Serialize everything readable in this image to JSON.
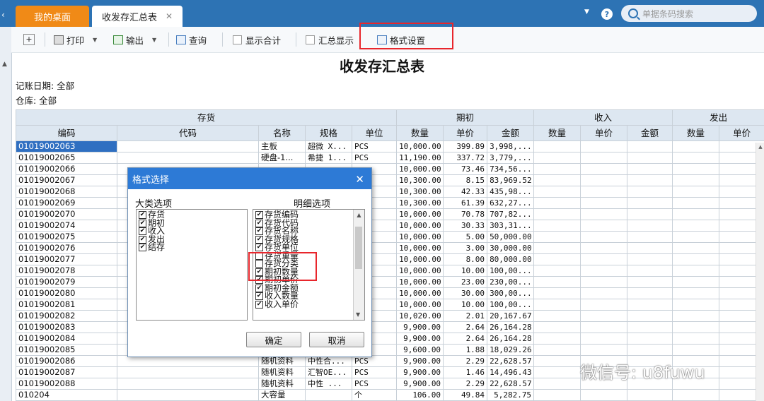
{
  "tabs": {
    "home": "我的桌面",
    "active": "收发存汇总表",
    "close": "✕"
  },
  "search": {
    "placeholder": "单据条码搜索"
  },
  "help": "?",
  "toolbar": {
    "add": "+",
    "print": "打印",
    "export": "输出",
    "query": "查询",
    "show_total": "显示合计",
    "summary_show": "汇总显示",
    "format_settings": "格式设置"
  },
  "report": {
    "title": "收发存汇总表",
    "date_filter": "记账日期: 全部",
    "warehouse_filter": "仓库: 全部"
  },
  "table": {
    "groups": [
      "存货",
      "期初",
      "收入",
      "发出"
    ],
    "columns": [
      "编码",
      "代码",
      "名称",
      "规格",
      "单位",
      "数量",
      "单价",
      "金额",
      "数量",
      "单价",
      "金额",
      "数量",
      "单价"
    ],
    "rows": [
      [
        "01019002063",
        "",
        "主板",
        "超微 X...",
        "PCS",
        "10,000.00",
        "399.89",
        "3,998,..."
      ],
      [
        "01019002065",
        "",
        "硬盘-1...",
        "希捷 1...",
        "PCS",
        "11,190.00",
        "337.72",
        "3,779,..."
      ],
      [
        "01019002066",
        "",
        "",
        "",
        "",
        "10,000.00",
        "73.46",
        "734,56..."
      ],
      [
        "01019002067",
        "",
        "",
        "",
        "",
        "10,300.00",
        "8.15",
        "83,969.52"
      ],
      [
        "01019002068",
        "",
        "",
        "",
        "",
        "10,300.00",
        "42.33",
        "435,98..."
      ],
      [
        "01019002069",
        "",
        "",
        "",
        "",
        "10,300.00",
        "61.39",
        "632,27..."
      ],
      [
        "01019002070",
        "",
        "",
        "",
        "",
        "10,000.00",
        "70.78",
        "707,82..."
      ],
      [
        "01019002074",
        "",
        "",
        "",
        "",
        "10,000.00",
        "30.33",
        "303,31..."
      ],
      [
        "01019002075",
        "",
        "",
        "",
        "",
        "10,000.00",
        "5.00",
        "50,000.00"
      ],
      [
        "01019002076",
        "",
        "",
        "",
        "",
        "10,000.00",
        "3.00",
        "30,000.00"
      ],
      [
        "01019002077",
        "",
        "",
        "",
        "",
        "10,000.00",
        "8.00",
        "80,000.00"
      ],
      [
        "01019002078",
        "",
        "",
        "",
        "",
        "10,000.00",
        "10.00",
        "100,00..."
      ],
      [
        "01019002079",
        "",
        "",
        "",
        "",
        "10,000.00",
        "23.00",
        "230,00..."
      ],
      [
        "01019002080",
        "",
        "",
        "",
        "",
        "10,000.00",
        "30.00",
        "300,00..."
      ],
      [
        "01019002081",
        "",
        "",
        "",
        "",
        "10,000.00",
        "10.00",
        "100,00..."
      ],
      [
        "01019002082",
        "",
        "",
        "",
        "",
        "10,020.00",
        "2.01",
        "20,167.67"
      ],
      [
        "01019002083",
        "",
        "",
        "",
        "",
        "9,900.00",
        "2.64",
        "26,164.28"
      ],
      [
        "01019002084",
        "",
        "",
        "",
        "",
        "9,900.00",
        "2.64",
        "26,164.28"
      ],
      [
        "01019002085",
        "",
        "",
        "",
        "",
        "9,600.00",
        "1.88",
        "18,029.26"
      ],
      [
        "01019002086",
        "",
        "随机资料",
        "中性合...",
        "PCS",
        "9,900.00",
        "2.29",
        "22,628.57"
      ],
      [
        "01019002087",
        "",
        "随机资料",
        "汇智OE...",
        "PCS",
        "9,900.00",
        "1.46",
        "14,496.43"
      ],
      [
        "01019002088",
        "",
        "随机资料",
        "中性 ...",
        "PCS",
        "9,900.00",
        "2.29",
        "22,628.57"
      ],
      [
        "010204",
        "",
        "大容量",
        "",
        "个",
        "106.00",
        "49.84",
        "5,282.75"
      ]
    ]
  },
  "dialog": {
    "title": "格式选择",
    "close": "✕",
    "left_label": "大类选项",
    "right_label": "明细选项",
    "categories": [
      {
        "label": "存货",
        "checked": true
      },
      {
        "label": "期初",
        "checked": true
      },
      {
        "label": "收入",
        "checked": true
      },
      {
        "label": "发出",
        "checked": true
      },
      {
        "label": "结存",
        "checked": true
      }
    ],
    "details": [
      {
        "label": "存货编码",
        "checked": true
      },
      {
        "label": "存货代码",
        "checked": true
      },
      {
        "label": "存货名称",
        "checked": true
      },
      {
        "label": "存货规格",
        "checked": true
      },
      {
        "label": "存货单位",
        "checked": true
      },
      {
        "label": "存货重量",
        "checked": false
      },
      {
        "label": "存货分类",
        "checked": false
      },
      {
        "label": "期初数量",
        "checked": true
      },
      {
        "label": "期初单价",
        "checked": true
      },
      {
        "label": "期初金额",
        "checked": true
      },
      {
        "label": "收入数量",
        "checked": true
      },
      {
        "label": "收入单价",
        "checked": true
      }
    ],
    "ok": "确定",
    "cancel": "取消"
  },
  "watermark": "微信号: u8fuwu"
}
